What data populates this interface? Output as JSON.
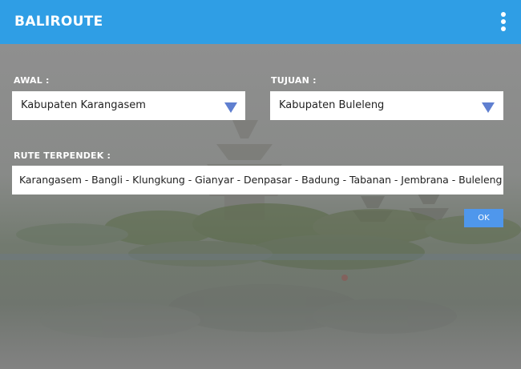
{
  "app": {
    "title": "BALIROUTE"
  },
  "form": {
    "start_label": "AWAL :",
    "start_value": "Kabupaten Karangasem",
    "destination_label": "TUJUAN :",
    "destination_value": "Kabupaten Buleleng",
    "route_label": "RUTE TERPENDEK :",
    "route_value": "Karangasem - Bangli - Klungkung - Gianyar - Denpasar - Badung - Tabanan - Jembrana - Buleleng",
    "ok_label": "OK"
  },
  "icons": {
    "menu": "more-vertical-icon",
    "dropdown": "caret-down-icon"
  },
  "colors": {
    "app_bar": "#2f9ee5",
    "caret": "#5f7fd0",
    "ok_button": "#4f97ec"
  }
}
